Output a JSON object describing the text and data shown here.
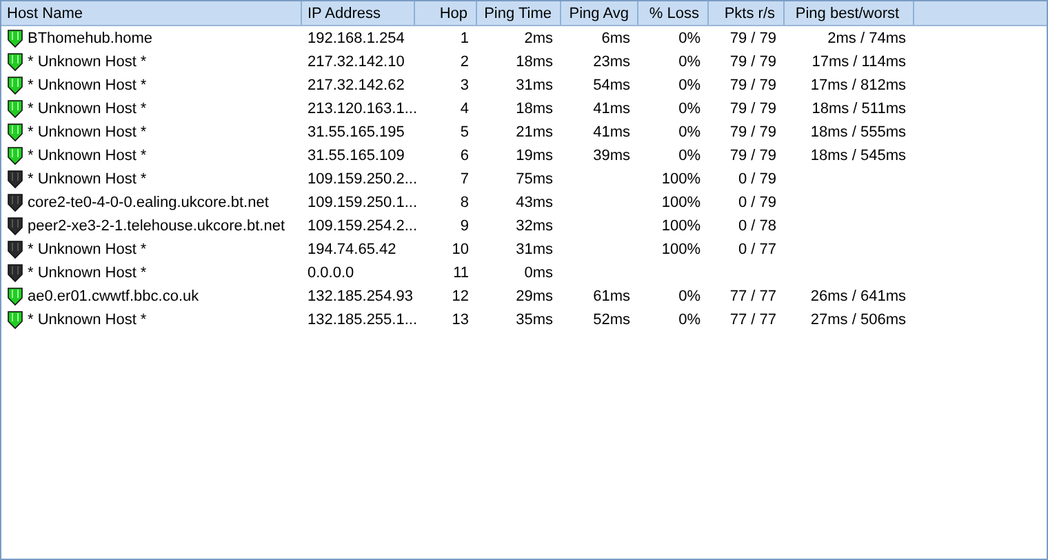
{
  "table": {
    "columns": [
      "Host Name",
      "IP Address",
      "Hop",
      "Ping Time",
      "Ping Avg",
      "% Loss",
      "Pkts r/s",
      "Ping best/worst"
    ],
    "rows": [
      {
        "reachable": true,
        "host": "BThomehub.home",
        "ip": "192.168.1.254",
        "hop": "1",
        "ping_time": "2ms",
        "ping_avg": "6ms",
        "loss": "0%",
        "pkts": "79 / 79",
        "best_worst": "2ms / 74ms"
      },
      {
        "reachable": true,
        "host": "* Unknown Host *",
        "ip": "217.32.142.10",
        "hop": "2",
        "ping_time": "18ms",
        "ping_avg": "23ms",
        "loss": "0%",
        "pkts": "79 / 79",
        "best_worst": "17ms / 114ms"
      },
      {
        "reachable": true,
        "host": "* Unknown Host *",
        "ip": "217.32.142.62",
        "hop": "3",
        "ping_time": "31ms",
        "ping_avg": "54ms",
        "loss": "0%",
        "pkts": "79 / 79",
        "best_worst": "17ms / 812ms"
      },
      {
        "reachable": true,
        "host": "* Unknown Host *",
        "ip": "213.120.163.1...",
        "hop": "4",
        "ping_time": "18ms",
        "ping_avg": "41ms",
        "loss": "0%",
        "pkts": "79 / 79",
        "best_worst": "18ms / 511ms"
      },
      {
        "reachable": true,
        "host": "* Unknown Host *",
        "ip": "31.55.165.195",
        "hop": "5",
        "ping_time": "21ms",
        "ping_avg": "41ms",
        "loss": "0%",
        "pkts": "79 / 79",
        "best_worst": "18ms / 555ms"
      },
      {
        "reachable": true,
        "host": "* Unknown Host *",
        "ip": "31.55.165.109",
        "hop": "6",
        "ping_time": "19ms",
        "ping_avg": "39ms",
        "loss": "0%",
        "pkts": "79 / 79",
        "best_worst": "18ms / 545ms"
      },
      {
        "reachable": false,
        "host": "* Unknown Host *",
        "ip": "109.159.250.2...",
        "hop": "7",
        "ping_time": "75ms",
        "loss": "100%",
        "pkts": "0 / 79"
      },
      {
        "reachable": false,
        "host": "core2-te0-4-0-0.ealing.ukcore.bt.net",
        "ip": "109.159.250.1...",
        "hop": "8",
        "ping_time": "43ms",
        "loss": "100%",
        "pkts": "0 / 79"
      },
      {
        "reachable": false,
        "host": "peer2-xe3-2-1.telehouse.ukcore.bt.net",
        "ip": "109.159.254.2...",
        "hop": "9",
        "ping_time": "32ms",
        "loss": "100%",
        "pkts": "0 / 78"
      },
      {
        "reachable": false,
        "host": "* Unknown Host *",
        "ip": "194.74.65.42",
        "hop": "10",
        "ping_time": "31ms",
        "loss": "100%",
        "pkts": "0 / 77"
      },
      {
        "reachable": false,
        "host": "* Unknown Host *",
        "ip": "0.0.0.0",
        "hop": "11",
        "ping_time": "0ms"
      },
      {
        "reachable": true,
        "host": "ae0.er01.cwwtf.bbc.co.uk",
        "ip": "132.185.254.93",
        "hop": "12",
        "ping_time": "29ms",
        "ping_avg": "61ms",
        "loss": "0%",
        "pkts": "77 / 77",
        "best_worst": "26ms / 641ms"
      },
      {
        "reachable": true,
        "host": "* Unknown Host *",
        "ip": "132.185.255.1...",
        "hop": "13",
        "ping_time": "35ms",
        "ping_avg": "52ms",
        "loss": "0%",
        "pkts": "77 / 77",
        "best_worst": "27ms / 506ms"
      }
    ]
  }
}
